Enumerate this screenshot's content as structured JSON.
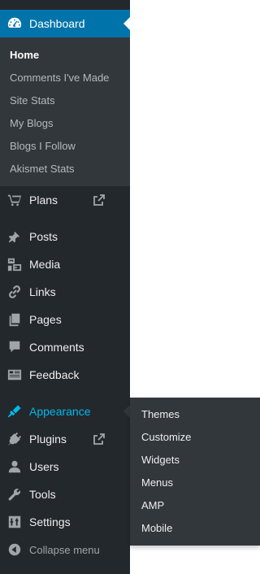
{
  "sidebar": {
    "dashboard": {
      "label": "Dashboard",
      "icon": "dashboard-icon"
    },
    "dashboard_submenu": [
      {
        "label": "Home",
        "current": true
      },
      {
        "label": "Comments I've Made"
      },
      {
        "label": "Site Stats"
      },
      {
        "label": "My Blogs"
      },
      {
        "label": "Blogs I Follow"
      },
      {
        "label": "Akismet Stats"
      }
    ],
    "items": [
      {
        "label": "Plans",
        "icon": "cart-icon",
        "external": true
      },
      {
        "label": "Posts",
        "icon": "pin-icon"
      },
      {
        "label": "Media",
        "icon": "media-icon"
      },
      {
        "label": "Links",
        "icon": "link-icon"
      },
      {
        "label": "Pages",
        "icon": "pages-icon"
      },
      {
        "label": "Comments",
        "icon": "comment-icon"
      },
      {
        "label": "Feedback",
        "icon": "feedback-icon"
      },
      {
        "label": "Appearance",
        "icon": "paintbrush-icon",
        "active": true
      },
      {
        "label": "Plugins",
        "icon": "plugin-icon",
        "external": true
      },
      {
        "label": "Users",
        "icon": "user-icon"
      },
      {
        "label": "Tools",
        "icon": "wrench-icon"
      },
      {
        "label": "Settings",
        "icon": "settings-icon"
      }
    ],
    "collapse": {
      "label": "Collapse menu",
      "icon": "collapse-icon"
    }
  },
  "appearance_flyout": [
    {
      "label": "Themes"
    },
    {
      "label": "Customize"
    },
    {
      "label": "Widgets"
    },
    {
      "label": "Menus"
    },
    {
      "label": "AMP"
    },
    {
      "label": "Mobile"
    }
  ],
  "colors": {
    "sidebar_bg": "#23282d",
    "submenu_bg": "#32373c",
    "accent": "#0073aa",
    "active_text": "#00b9eb",
    "icon": "#a0a5aa"
  }
}
